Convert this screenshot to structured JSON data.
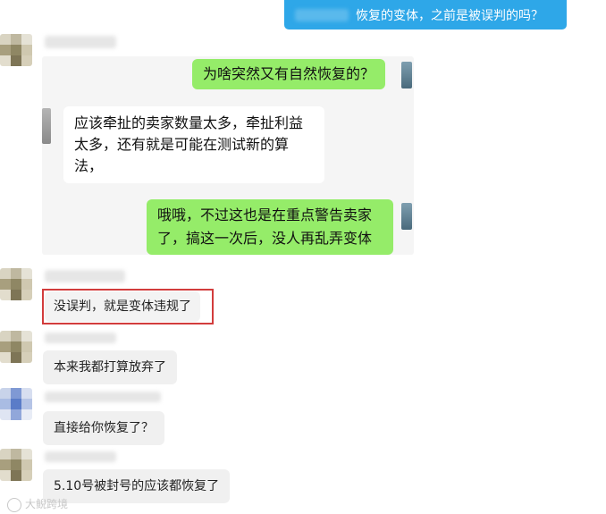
{
  "outgoing_top": {
    "text": "恢复的变体，之前是被误判的吗？"
  },
  "embedded_chat": {
    "msg1": "为啥突然又有自然恢复的？",
    "msg2": "应该牵扯的卖家数量太多，牵扯利益太多，还有就是可能在测试新的算法，",
    "msg3": "哦哦，不过这也是在重点警告卖家了，搞这一次后，没人再乱弄变体"
  },
  "messages": [
    {
      "text": "没误判，就是变体违规了",
      "highlighted": true
    },
    {
      "text": "本来我都打算放弃了"
    },
    {
      "text": "直接给你恢复了？"
    },
    {
      "text": "5.10号被封号的应该都恢复了"
    }
  ],
  "watermark": {
    "text": "大鲵跨境"
  },
  "colors": {
    "outgoing_bubble": "#2ea7e8",
    "incoming_bubble": "#f0f0f0",
    "green_bubble": "#95ec69",
    "highlight_border": "#d23c3c"
  }
}
